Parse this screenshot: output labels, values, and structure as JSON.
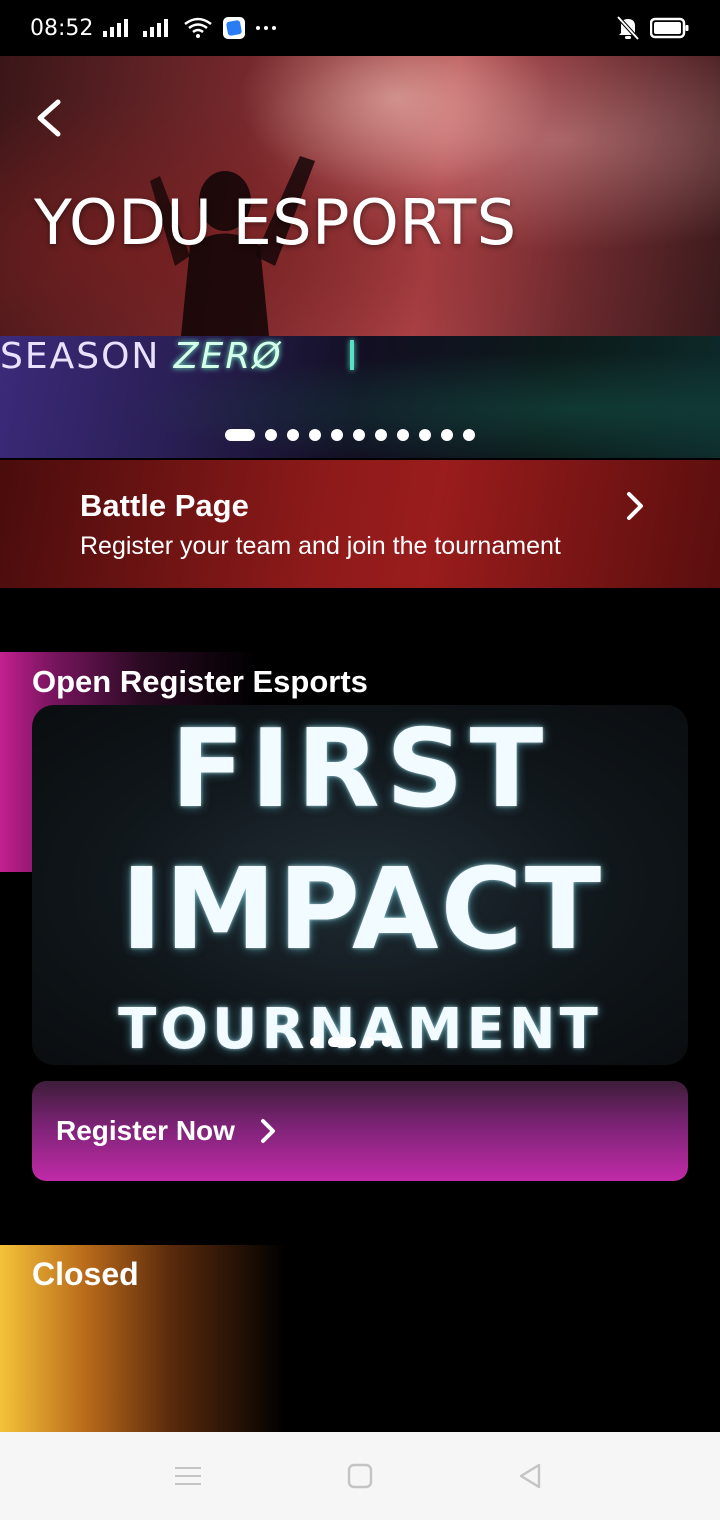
{
  "status_bar": {
    "time": "08:52",
    "icons": [
      "signal-icon",
      "signal-icon",
      "wifi-icon",
      "app-notification-icon",
      "more-icon",
      "silent-icon",
      "battery-icon"
    ]
  },
  "hero": {
    "title": "YODU ESPORTS",
    "back_icon": "back-arrow-icon"
  },
  "banner": {
    "text_season": "SEASON",
    "text_zero": "ZERØ",
    "slide_count": 12,
    "active_slide": 0
  },
  "battle_page": {
    "title": "Battle Page",
    "subtitle": "Register your team and join the tournament",
    "icon": "chevron-right-icon"
  },
  "open_register": {
    "section_title": "Open Register Esports",
    "card": {
      "line1": "FIRST",
      "line2": "IMPACT",
      "line3": "TOURNAMENT"
    },
    "slide_count": 4,
    "active_slide": 1,
    "register_button_label": "Register Now"
  },
  "closed": {
    "section_title": "Closed"
  },
  "nav_bar": {
    "icons": [
      "menu-icon",
      "home-icon",
      "back-icon"
    ]
  },
  "colors": {
    "battle_red": "#8e1a1a",
    "accent_pink": "#c3208f",
    "accent_gold": "#f5c33a",
    "register_pink": "#c12aa8"
  }
}
